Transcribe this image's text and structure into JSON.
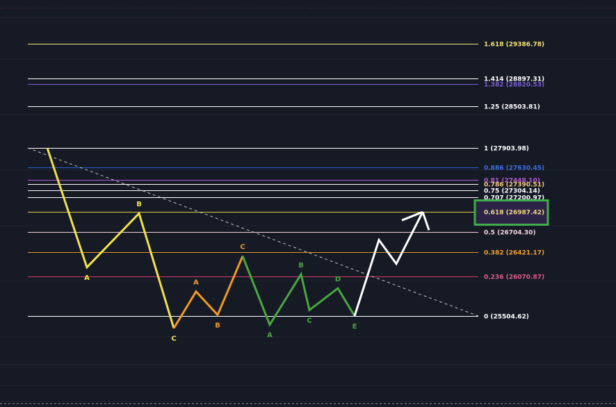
{
  "chart_data": {
    "type": "line",
    "title": "",
    "xlabel": "",
    "ylabel": "",
    "grid": true,
    "fib_levels": [
      {
        "ratio": "1.618",
        "price": 29386.78,
        "text": "1.618 (29386.78)",
        "color": "#f5e27a",
        "line_color": "#f5e27a"
      },
      {
        "ratio": "1.414",
        "price": 28897.31,
        "text": "1.414 (28897.31)",
        "color": "#ffffff",
        "line_color": "#ffffff"
      },
      {
        "ratio": "1.382",
        "price": 28820.53,
        "text": "1.382 (28820.53)",
        "color": "#7b5fd6",
        "line_color": "#7b5fd6"
      },
      {
        "ratio": "1.25",
        "price": 28503.81,
        "text": "1.25 (28503.81)",
        "color": "#ffffff",
        "line_color": "#ffffff"
      },
      {
        "ratio": "1",
        "price": 27903.98,
        "text": "1 (27903.98)",
        "color": "#ffffff",
        "line_color": "#ffffff"
      },
      {
        "ratio": "0.886",
        "price": 27630.45,
        "text": "0.886 (27630.45)",
        "color": "#3d6fe0",
        "line_color": "#2f5fd0"
      },
      {
        "ratio": "0.81",
        "price": 27448.1,
        "text": "0.81 (27448.10)",
        "color": "#b05ad0",
        "line_color": "#b05ad0"
      },
      {
        "ratio": "0.786",
        "price": 27390.51,
        "text": "0.786 (27390.51)",
        "color": "#f2c879",
        "line_color": "#ffffff"
      },
      {
        "ratio": "0.75",
        "price": 27304.14,
        "text": "0.75 (27304.14)",
        "color": "#ffffff",
        "line_color": "#ffffff"
      },
      {
        "ratio": "0.707",
        "price": 27200.97,
        "text": "0.707 (27200.97)",
        "color": "#ffffff",
        "line_color": "#ffffff"
      },
      {
        "ratio": "0.618",
        "price": 26987.42,
        "text": "0.618 (26987.42)",
        "color": "#f2d58a",
        "line_color": "#e6c84a"
      },
      {
        "ratio": "0.5",
        "price": 26704.3,
        "text": "0.5 (26704.30)",
        "color": "#f4d4dc",
        "line_color": "#f4d4dc"
      },
      {
        "ratio": "0.382",
        "price": 26421.17,
        "text": "0.382 (26421.17)",
        "color": "#f0a030",
        "line_color": "#e69a2a"
      },
      {
        "ratio": "0.236",
        "price": 26070.87,
        "text": "0.236 (26070.87)",
        "color": "#e05a8a",
        "line_color": "#d03a6a"
      },
      {
        "ratio": "0",
        "price": 25504.62,
        "text": "0 (25504.62)",
        "color": "#ffffff",
        "line_color": "#ffffff"
      }
    ],
    "highlight_level": "0.618",
    "highlight_box_color": "#3fae4a",
    "series": [
      {
        "color": "#f2e24a",
        "points": [
          [
            68,
            27903.98
          ],
          [
            125,
            26200.0
          ],
          [
            200,
            26970.0
          ],
          [
            250,
            25330.0
          ]
        ],
        "labels": [
          {
            "text": "A",
            "point": 1,
            "pos": "below"
          },
          {
            "text": "B",
            "point": 2,
            "pos": "above"
          },
          {
            "text": "C",
            "point": 3,
            "pos": "below"
          }
        ]
      },
      {
        "color": "#f29a22",
        "points": [
          [
            250,
            25330.0
          ],
          [
            282,
            25855.0
          ],
          [
            313,
            25520.0
          ],
          [
            349,
            26360.0
          ]
        ],
        "labels": [
          {
            "text": "A",
            "point": 1,
            "pos": "above"
          },
          {
            "text": "B",
            "point": 2,
            "pos": "below"
          },
          {
            "text": "C",
            "point": 3,
            "pos": "above"
          }
        ]
      },
      {
        "color": "#4aa63e",
        "points": [
          [
            349,
            26360.0
          ],
          [
            388,
            25380.0
          ],
          [
            433,
            26100.0
          ],
          [
            445,
            25590.0
          ],
          [
            486,
            25900.0
          ],
          [
            510,
            25504.62
          ]
        ],
        "labels": [
          {
            "text": "A",
            "point": 1,
            "pos": "below"
          },
          {
            "text": "B",
            "point": 2,
            "pos": "above"
          },
          {
            "text": "C",
            "point": 3,
            "pos": "below"
          },
          {
            "text": "D",
            "point": 4,
            "pos": "above"
          },
          {
            "text": "E",
            "point": 5,
            "pos": "below"
          }
        ]
      },
      {
        "color": "#ffffff",
        "points": [
          [
            510,
            25504.62
          ],
          [
            545,
            26590.0
          ],
          [
            570,
            26250.0
          ],
          [
            608,
            26990.0
          ]
        ],
        "labels": []
      }
    ],
    "projection_tail": [
      608,
      26990.0,
      617,
      26730.0
    ],
    "trendline": {
      "from": [
        40,
        27903.98
      ],
      "to": [
        688,
        25504.62
      ],
      "color": "#c8c8c8",
      "dashed": true
    }
  }
}
